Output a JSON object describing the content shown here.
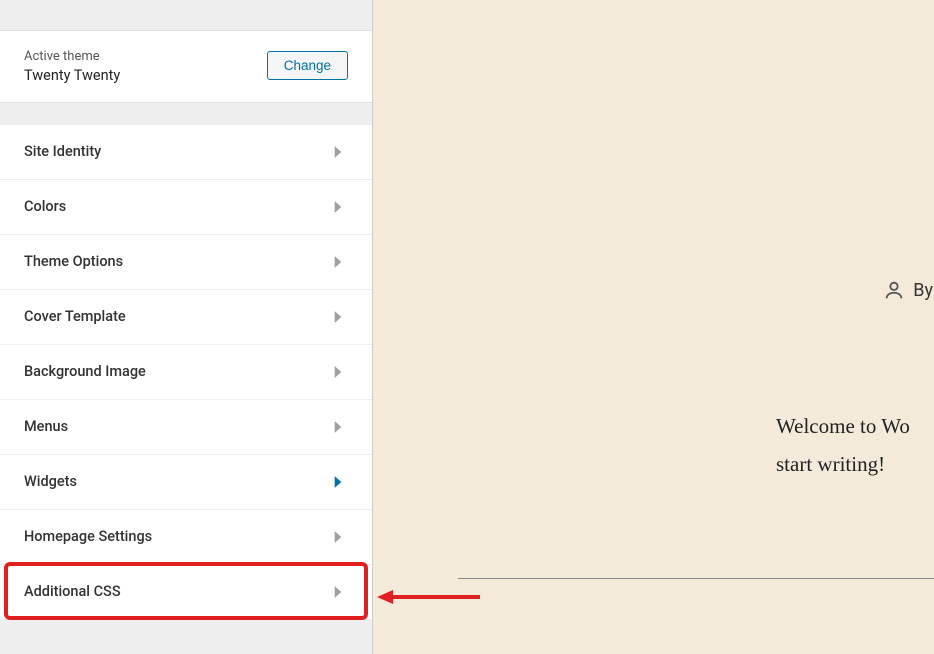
{
  "theme": {
    "active_label": "Active theme",
    "name": "Twenty Twenty",
    "change_button": "Change"
  },
  "menu": {
    "items": [
      {
        "label": "Site Identity",
        "active": false
      },
      {
        "label": "Colors",
        "active": false
      },
      {
        "label": "Theme Options",
        "active": false
      },
      {
        "label": "Cover Template",
        "active": false
      },
      {
        "label": "Background Image",
        "active": false
      },
      {
        "label": "Menus",
        "active": false
      },
      {
        "label": "Widgets",
        "active": true
      },
      {
        "label": "Homepage Settings",
        "active": false
      },
      {
        "label": "Additional CSS",
        "active": false
      }
    ]
  },
  "preview": {
    "byline": "By",
    "welcome_line1": "Welcome to Wo",
    "welcome_line2": "start writing!"
  }
}
